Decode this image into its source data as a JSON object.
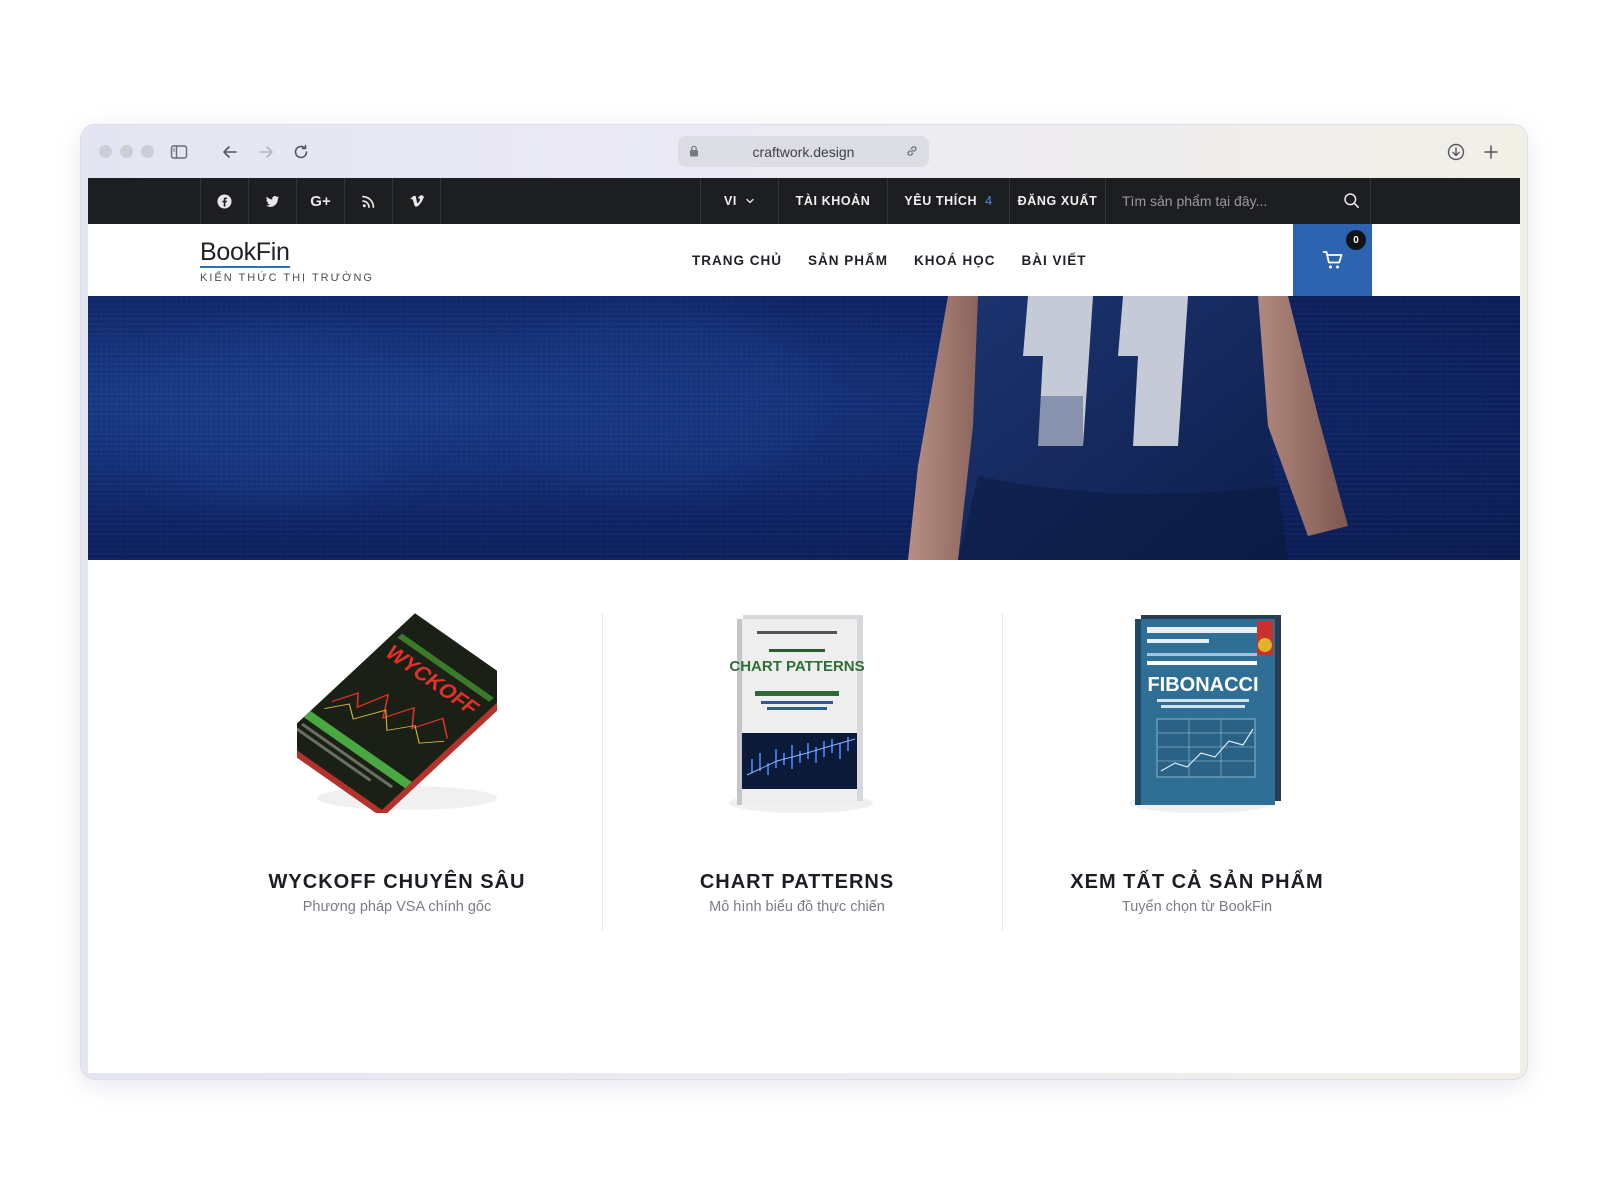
{
  "browser": {
    "url": "craftwork.design"
  },
  "topbar": {
    "social": [
      "facebook-icon",
      "twitter-icon",
      "G+",
      "rss-icon",
      "vimeo-icon"
    ],
    "google_plus": "G+",
    "language": "VI",
    "account": "TÀI KHOẢN",
    "favorites": "YÊU THÍCH",
    "favorites_count": "4",
    "logout": "ĐĂNG XUẤT",
    "search_placeholder": "Tìm sản phẩm tại đây..."
  },
  "header": {
    "logo_title": "BookFin",
    "logo_subtitle": "KIẾN THỨC THỊ TRƯỜNG",
    "nav": [
      "TRANG CHỦ",
      "SẢN PHẨM",
      "KHOÁ HỌC",
      "BÀI VIẾT"
    ],
    "cart_count": "0"
  },
  "products": [
    {
      "name": "WYCKOFF CHUYÊN SÂU",
      "subtitle": "Phương pháp VSA chính gốc",
      "cover_title": "WYCKOFF"
    },
    {
      "name": "CHART PATTERNS",
      "subtitle": "Mô hình biểu đồ thực chiến",
      "cover_title": "CHART PATTERNS"
    },
    {
      "name": "XEM TẤT CẢ SẢN PHẨM",
      "subtitle": "Tuyển chọn từ BookFin",
      "cover_title": "FIBONACCI"
    }
  ],
  "colors": {
    "topbar": "#1d1e20",
    "accent": "#2e63b1",
    "hero": "#0e2466"
  }
}
